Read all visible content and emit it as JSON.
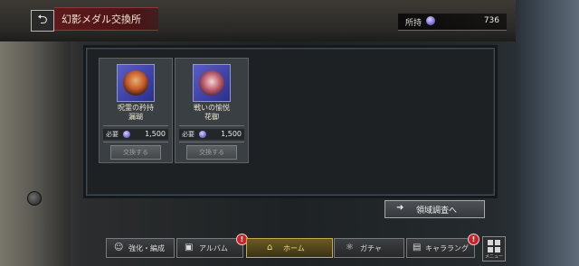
{
  "header": {
    "back_icon": "back-arrow-icon",
    "title": "幻影メダル交換所"
  },
  "currency": {
    "label": "所持",
    "icon": "phantom-medal-icon",
    "value": "736"
  },
  "items": [
    {
      "name": "呪霊の矜持",
      "sub_name": "漏瑚",
      "cost_label": "必要",
      "cost_icon": "phantom-medal-icon",
      "cost_value": "1,500",
      "button_label": "交換する"
    },
    {
      "name": "戦いの愉悦",
      "sub_name": "花御",
      "cost_label": "必要",
      "cost_icon": "phantom-medal-icon",
      "cost_value": "1,500",
      "button_label": "交換する"
    }
  ],
  "survey_button": {
    "icon": "arrow-right-icon",
    "label": "領域調査へ"
  },
  "nav": {
    "tabs": [
      {
        "label": "強化・編成",
        "icon": "party-icon",
        "badge": ""
      },
      {
        "label": "アルバム",
        "icon": "album-icon",
        "badge": "!"
      },
      {
        "label": "ホーム",
        "icon": "home-icon",
        "badge": ""
      },
      {
        "label": "ガチャ",
        "icon": "gacha-icon",
        "badge": ""
      },
      {
        "label": "キャララング",
        "icon": "character-icon",
        "badge": "!"
      }
    ],
    "menu_label": "メニュー"
  },
  "colors": {
    "title_banner": "#5e1a1c",
    "active_tab": "#c9a94a",
    "badge": "#c8242c",
    "medal": "#7d6fd6"
  }
}
